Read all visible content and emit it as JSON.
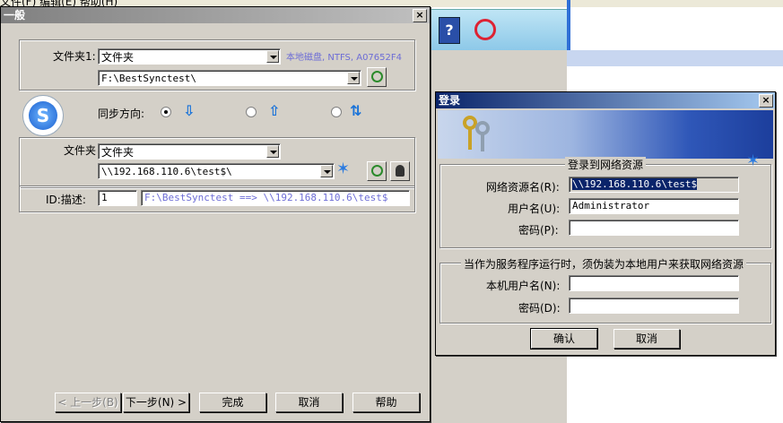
{
  "background": {
    "menu": "文件(F)  编辑(E)  帮助(H)"
  },
  "general_dialog": {
    "title": "一般",
    "folder1": {
      "label": "文件夹1:",
      "type_value": "文件夹",
      "disk_info": "本地磁盘, NTFS, A07652F4",
      "path_value": "F:\\BestSynctest\\"
    },
    "sync_direction": {
      "label": "同步方向:",
      "selected": 0
    },
    "folder2": {
      "label": "文件夹",
      "type_value": "文件夹",
      "path_value": "\\\\192.168.110.6\\test$\\"
    },
    "id_row": {
      "label": "ID:描述:",
      "id_value": "1",
      "description": "F:\\BestSynctest ==> \\\\192.168.110.6\\test$"
    },
    "buttons": {
      "back": "< 上一步(B)",
      "next": "下一步(N) >",
      "finish": "完成",
      "cancel": "取消",
      "help": "帮助"
    }
  },
  "login_dialog": {
    "title": "登录",
    "group1_title": "登录到网络资源",
    "resource_label": "网络资源名(R):",
    "resource_value": "\\\\192.168.110.6\\test$",
    "user_label": "用户名(U):",
    "user_value": "Administrator",
    "password_label": "密码(P):",
    "password_value": "",
    "group2_title": "当作为服务程序运行时，须伪装为本地用户来获取网络资源",
    "local_user_label": "本机用户名(N):",
    "local_user_value": "",
    "local_password_label": "密码(D):",
    "local_password_value": "",
    "ok": "确认",
    "cancel": "取消"
  },
  "colors": {
    "title_active": "#0a246a",
    "dialog_face": "#d4d0c8",
    "disk_info_text": "#6d6dd6",
    "arrow_blue": "#1a73d9"
  }
}
